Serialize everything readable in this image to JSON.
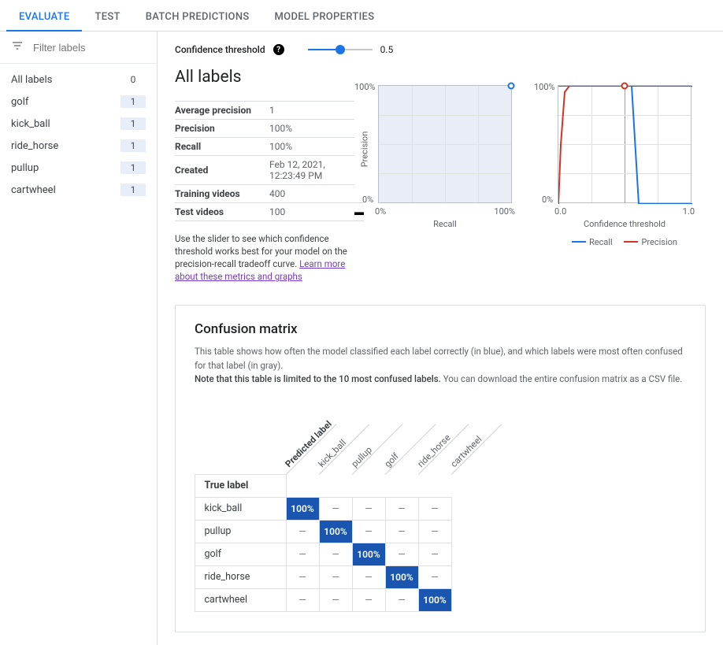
{
  "tabs": {
    "evaluate": "EVALUATE",
    "test": "TEST",
    "batch": "BATCH PREDICTIONS",
    "props": "MODEL PROPERTIES"
  },
  "sidebar": {
    "filter_placeholder": "Filter labels",
    "all_label": "All labels",
    "all_count": "0",
    "items": [
      {
        "label": "golf",
        "count": "1"
      },
      {
        "label": "kick_ball",
        "count": "1"
      },
      {
        "label": "ride_horse",
        "count": "1"
      },
      {
        "label": "pullup",
        "count": "1"
      },
      {
        "label": "cartwheel",
        "count": "1"
      }
    ]
  },
  "threshold": {
    "label": "Confidence threshold",
    "value": "0.5"
  },
  "section_title": "All labels",
  "metrics": [
    {
      "k": "Average precision",
      "v": "1"
    },
    {
      "k": "Precision",
      "v": "100%"
    },
    {
      "k": "Recall",
      "v": "100%"
    },
    {
      "k": "Created",
      "v": "Feb 12, 2021, 12:23:49 PM"
    },
    {
      "k": "Training videos",
      "v": "400"
    },
    {
      "k": "Test videos",
      "v": "100"
    }
  ],
  "hint_prefix": "Use the slider to see which confidence threshold works best for your model on the precision-recall tradeoff curve. ",
  "hint_link": "Learn more about these metrics and graphs",
  "chart1": {
    "yaxis": "Precision",
    "xaxis": "Recall",
    "ytop": "100%",
    "ybot": "0%",
    "xleft": "0%",
    "xright": "100%"
  },
  "chart2": {
    "xaxis": "Confidence threshold",
    "ytop": "100%",
    "ybot": "0%",
    "xleft": "0.0",
    "xright": "1.0",
    "legend_recall": "Recall",
    "legend_precision": "Precision"
  },
  "chart_data": {
    "type": "line",
    "charts": [
      {
        "name": "precision_recall_curve",
        "xlabel": "Recall",
        "ylabel": "Precision",
        "xlim": [
          0,
          100
        ],
        "ylim": [
          0,
          100
        ],
        "series": [
          {
            "name": "PR",
            "x": [
              0,
              100
            ],
            "y": [
              100,
              100
            ]
          }
        ],
        "marker": {
          "x": 100,
          "y": 100
        }
      },
      {
        "name": "threshold_curves",
        "xlabel": "Confidence threshold",
        "ylabel": "",
        "xlim": [
          0.0,
          1.0
        ],
        "ylim": [
          0,
          100
        ],
        "series": [
          {
            "name": "Recall",
            "color": "#1a73e8",
            "x": [
              0.0,
              0.5,
              0.55,
              0.6,
              1.0
            ],
            "y": [
              100,
              100,
              100,
              0,
              0
            ]
          },
          {
            "name": "Precision",
            "color": "#d93025",
            "x": [
              0.0,
              0.02,
              0.05,
              0.08,
              1.0
            ],
            "y": [
              0,
              50,
              95,
              100,
              100
            ]
          }
        ],
        "marker": {
          "x": 0.5,
          "y": 100
        }
      }
    ]
  },
  "cm": {
    "title": "Confusion matrix",
    "desc1": "This table shows how often the model classified each label correctly (in blue), and which labels were most often confused for that label (in gray).",
    "desc2_bold": "Note that this table is limited to the 10 most confused labels.",
    "desc2_rest": " You can download the entire confusion matrix as a CSV file.",
    "predicted_label": "Predicted label",
    "true_label": "True label",
    "cols": [
      "kick_ball",
      "pullup",
      "golf",
      "ride_horse",
      "cartwheel"
    ],
    "rows": [
      "kick_ball",
      "pullup",
      "golf",
      "ride_horse",
      "cartwheel"
    ],
    "hit": "100%",
    "dash": "—"
  }
}
